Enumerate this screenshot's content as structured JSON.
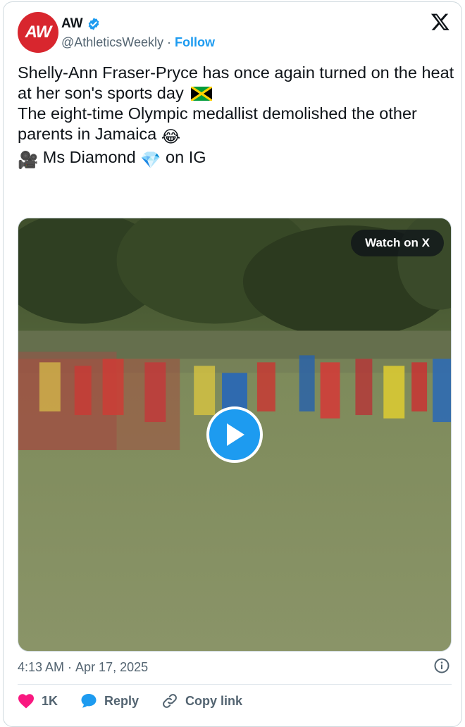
{
  "header": {
    "avatar_text": "AW",
    "display_name": "AW",
    "handle": "@AthleticsWeekly",
    "separator": "·",
    "follow_label": "Follow",
    "brand_color": "#d8262e",
    "accent_color": "#1d9bf0"
  },
  "tweet": {
    "line1": "Shelly-Ann Fraser-Pryce has once again turned on the heat at her son's sports day",
    "line1_emoji": "jamaica-flag",
    "line2": "The eight-time Olympic medallist demolished the other parents in Jamaica",
    "line2_emoji": "😂",
    "credit_prefix_emoji": "🎥",
    "credit_name": "Ms Diamond",
    "credit_gem_emoji": "💎",
    "credit_suffix": "on IG"
  },
  "media": {
    "watch_label": "Watch on X",
    "play_icon": "play-icon"
  },
  "footer": {
    "time": "4:13 AM",
    "separator": "·",
    "date": "Apr 17, 2025",
    "info_icon": "info-icon"
  },
  "actions": {
    "like_count": "1K",
    "reply_label": "Reply",
    "copy_label": "Copy link"
  }
}
